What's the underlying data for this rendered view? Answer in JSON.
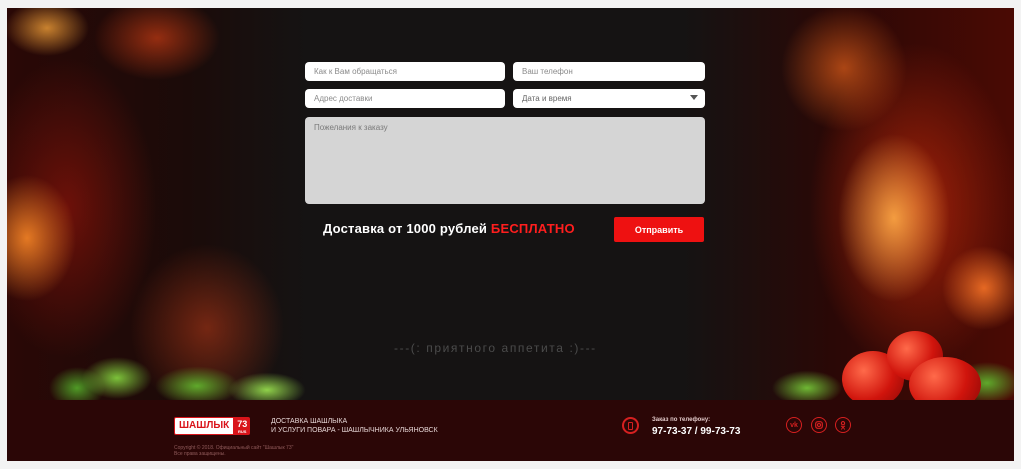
{
  "form": {
    "name_placeholder": "Как к Вам обращаться",
    "phone_placeholder": "Ваш телефон",
    "address_placeholder": "Адрес доставки",
    "datetime_label": "Дата и время",
    "wishes_placeholder": "Пожелания к заказу",
    "delivery_text": "Доставка от 1000 рублей",
    "delivery_free": "БЕСПЛАТНО",
    "submit_label": "Отправить"
  },
  "bon_appetit": "---(: приятного аппетита :)---",
  "footer": {
    "logo_word": "ШАШЛЫК",
    "logo_number": "73",
    "logo_suffix": "RUS",
    "tagline_line1": "ДОСТАВКА ШАШЛЫКА",
    "tagline_line2": "И УСЛУГИ ПОВАРА - ШАШЛЫЧНИКА  УЛЬЯНОВСК",
    "copyright_line1": "Copyright © 2018. Официальный сайт \"Шашлык 73\"",
    "copyright_line2": "Все права защищены.",
    "order_label": "Заказ по телефону:",
    "order_phones": "97-73-37  /  99-73-73",
    "social": {
      "vk": "vk-icon",
      "instagram": "instagram-icon",
      "ok": "odnoklassniki-icon",
      "phone": "phone-icon"
    }
  },
  "colors": {
    "accent": "#ee1111",
    "footer_bg": "#2b0606",
    "page_bg": "#151313"
  }
}
